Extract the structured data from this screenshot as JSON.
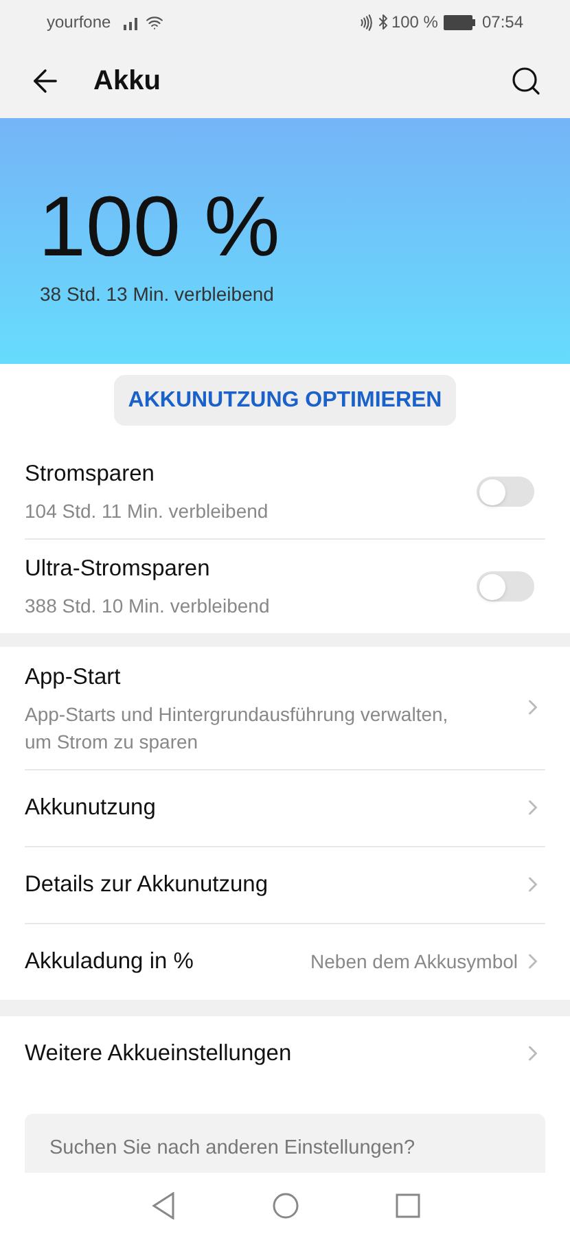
{
  "status_bar": {
    "carrier": "yourfone",
    "battery": "100 %",
    "time": "07:54"
  },
  "header": {
    "title": "Akku"
  },
  "hero": {
    "percent": "100 %",
    "remaining": "38 Std. 13 Min. verbleibend"
  },
  "optimize_button": "AKKUNUTZUNG OPTIMIEREN",
  "toggles": [
    {
      "title": "Stromsparen",
      "subtitle": "104 Std. 11 Min. verbleibend",
      "on": false
    },
    {
      "title": "Ultra-Stromsparen",
      "subtitle": "388 Std. 10 Min. verbleibend",
      "on": false
    }
  ],
  "settings": [
    {
      "title": "App-Start",
      "subtitle": "App-Starts und Hintergrundausführung verwalten, um Strom zu sparen"
    },
    {
      "title": "Akkunutzung"
    },
    {
      "title": "Details zur Akkunutzung"
    },
    {
      "title": "Akkuladung in %",
      "value": "Neben dem Akkusymbol"
    }
  ],
  "more_settings": [
    {
      "title": "Weitere Akkueinstellungen"
    }
  ],
  "suggestion": "Suchen Sie nach anderen Einstellungen?"
}
